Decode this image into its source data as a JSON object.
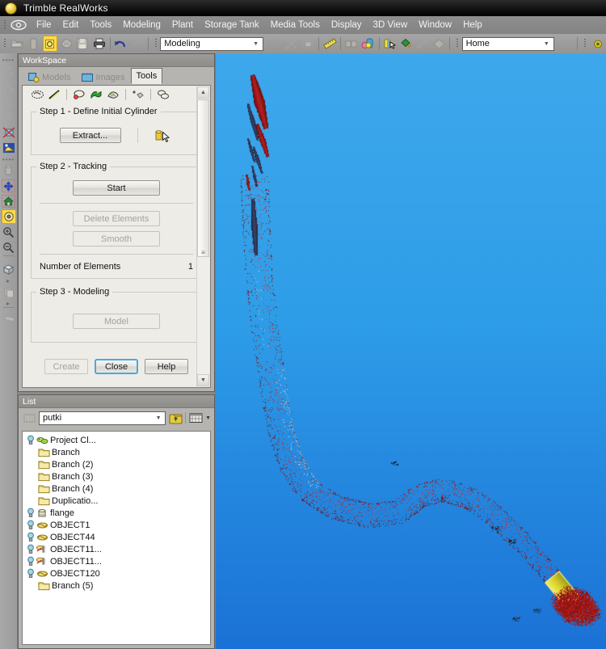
{
  "window": {
    "title": "Trimble RealWorks",
    "app_icon": "orb-icon"
  },
  "menu": {
    "items": [
      {
        "label": "File"
      },
      {
        "label": "Edit"
      },
      {
        "label": "Tools"
      },
      {
        "label": "Modeling"
      },
      {
        "label": "Plant"
      },
      {
        "label": "Storage Tank"
      },
      {
        "label": "Media Tools"
      },
      {
        "label": "Display"
      },
      {
        "label": "3D View"
      },
      {
        "label": "Window"
      },
      {
        "label": "Help"
      }
    ]
  },
  "toolbar": {
    "mode_combo_value": "Modeling",
    "view_combo_value": "Home",
    "buttons": [
      {
        "name": "open-project-icon",
        "state": "disabled"
      },
      {
        "name": "save-station-icon",
        "state": "disabled"
      },
      {
        "name": "highlight-icon",
        "state": "selected"
      },
      {
        "name": "cloud-icon",
        "state": "disabled"
      },
      {
        "name": "save-icon",
        "state": "disabled"
      },
      {
        "name": "print-icon",
        "state": "enabled"
      },
      {
        "name": "undo-icon",
        "state": "enabled"
      },
      {
        "name": "redo-icon",
        "state": "disabled"
      },
      {
        "name": "segment-icon",
        "state": "disabled"
      },
      {
        "name": "cut-cloud-icon",
        "state": "disabled"
      },
      {
        "name": "grid-select-icon",
        "state": "disabled"
      },
      {
        "name": "measure-icon",
        "state": "enabled"
      },
      {
        "name": "registration-icon",
        "state": "disabled"
      },
      {
        "name": "colorize-icon",
        "state": "enabled"
      },
      {
        "name": "pick-color-icon",
        "state": "enabled"
      },
      {
        "name": "paint-bucket-icon",
        "state": "enabled"
      },
      {
        "name": "link-icon",
        "state": "disabled"
      },
      {
        "name": "diamond-icon",
        "state": "disabled"
      },
      {
        "name": "axis-icon",
        "state": "disabled"
      }
    ]
  },
  "left_toolbar": {
    "items": [
      {
        "name": "dots-separator-1",
        "kind": "dots"
      },
      {
        "name": "rotate-icon",
        "state": "disabled"
      },
      {
        "name": "scissors-icon",
        "state": "disabled"
      },
      {
        "name": "clip-icon",
        "state": "disabled"
      },
      {
        "name": "cut-icon",
        "state": "disabled"
      },
      {
        "name": "limit-box-icon",
        "state": "enabled"
      },
      {
        "name": "pick-point-icon",
        "state": "enabled"
      },
      {
        "name": "dots-separator-2",
        "kind": "dots"
      },
      {
        "name": "cylinder-icon",
        "state": "disabled"
      },
      {
        "name": "pan-icon",
        "state": "enabled"
      },
      {
        "name": "home-view-icon",
        "state": "enabled"
      },
      {
        "name": "orbit-icon",
        "state": "selected"
      },
      {
        "name": "zoom-in-icon",
        "state": "enabled"
      },
      {
        "name": "zoom-out-icon",
        "state": "enabled"
      },
      {
        "name": "separator-1",
        "kind": "hr"
      },
      {
        "name": "box-view-icon",
        "state": "enabled"
      },
      {
        "name": "small-caret-1",
        "kind": "caret"
      },
      {
        "name": "copy-view-icon",
        "state": "disabled"
      },
      {
        "name": "small-caret-2",
        "kind": "caret"
      },
      {
        "name": "separator-2",
        "kind": "hr"
      },
      {
        "name": "flag-icon",
        "state": "disabled"
      }
    ]
  },
  "workspace": {
    "caption": "WorkSpace",
    "tabs": [
      {
        "label": "Models",
        "icon": "models-icon",
        "active": false
      },
      {
        "label": "Images",
        "icon": "images-icon",
        "active": false
      },
      {
        "label": "Tools",
        "icon": "",
        "active": true
      }
    ],
    "tool_icons": [
      {
        "name": "pipe-run-icon"
      },
      {
        "name": "line-icon"
      },
      {
        "name": "cloud-fit-icon"
      },
      {
        "name": "green-patch-icon"
      },
      {
        "name": "surface-icon"
      },
      {
        "name": "add-point-icon"
      },
      {
        "name": "multi-cloud-icon"
      }
    ],
    "step1": {
      "label": "Step 1 - Define Initial Cylinder",
      "extract_button": "Extract...",
      "pick_icon": "cylinder-pick-icon"
    },
    "step2": {
      "label": "Step 2 - Tracking",
      "start_button": "Start",
      "delete_button": "Delete Elements",
      "smooth_button": "Smooth",
      "elements_label": "Number of Elements",
      "elements_value": "1"
    },
    "step3": {
      "label": "Step 3 - Modeling",
      "model_button": "Model"
    },
    "dialog_buttons": {
      "create": "Create",
      "close": "Close",
      "help": "Help"
    }
  },
  "list": {
    "caption": "List",
    "combo_value": "putki",
    "toolbar": [
      {
        "name": "list-filter-icon"
      },
      {
        "name": "up-folder-icon"
      },
      {
        "name": "view-mode-icon"
      }
    ],
    "tree": [
      {
        "label": "Project Cl...",
        "icon": "project-icon",
        "bulb": true,
        "indent": 0
      },
      {
        "label": "Branch",
        "icon": "folder-icon",
        "bulb": false,
        "indent": 1
      },
      {
        "label": "Branch (2)",
        "icon": "folder-icon",
        "bulb": false,
        "indent": 1
      },
      {
        "label": "Branch (3)",
        "icon": "folder-icon",
        "bulb": false,
        "indent": 1
      },
      {
        "label": "Branch (4)",
        "icon": "folder-icon",
        "bulb": false,
        "indent": 1
      },
      {
        "label": "Duplicatio...",
        "icon": "folder-icon",
        "bulb": false,
        "indent": 1
      },
      {
        "label": "flange",
        "icon": "flange-icon",
        "bulb": true,
        "indent": 0
      },
      {
        "label": "OBJECT1",
        "icon": "object-icon",
        "bulb": true,
        "indent": 0
      },
      {
        "label": "OBJECT44",
        "icon": "object-icon",
        "bulb": true,
        "indent": 0
      },
      {
        "label": "OBJECT11...",
        "icon": "pipe-object-icon",
        "bulb": true,
        "indent": 0
      },
      {
        "label": "OBJECT11...",
        "icon": "pipe-object-icon",
        "bulb": true,
        "indent": 0
      },
      {
        "label": "OBJECT120",
        "icon": "object-icon",
        "bulb": true,
        "indent": 0
      },
      {
        "label": "Branch (5)",
        "icon": "folder-icon",
        "bulb": false,
        "indent": 1
      }
    ]
  },
  "viewport": {
    "name": "3d-point-cloud-view",
    "background_top": "#3ea8ec",
    "background_bottom": "#1b72d6",
    "cloud_color": "#8f1010",
    "cloud_highlight": "#c62424",
    "fitted_cylinder_color": "#d8d32a"
  }
}
